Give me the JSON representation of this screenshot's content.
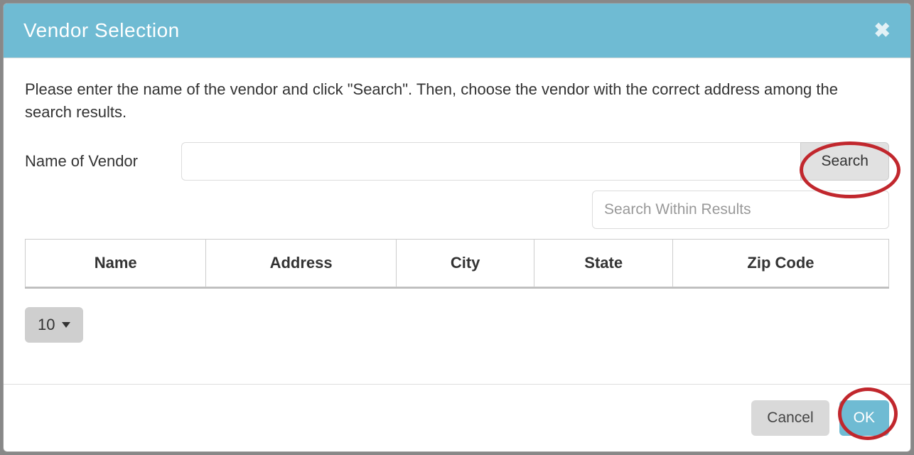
{
  "modal": {
    "title": "Vendor Selection",
    "instructions": "Please enter the name of the vendor and click \"Search\". Then, choose the vendor with the correct address among the search results.",
    "vendor_label": "Name of Vendor",
    "vendor_value": "",
    "search_button": "Search",
    "within_placeholder": "Search Within Results",
    "within_value": ""
  },
  "table": {
    "columns": [
      "Name",
      "Address",
      "City",
      "State",
      "Zip Code"
    ],
    "rows": []
  },
  "pager": {
    "page_size": "10"
  },
  "footer": {
    "cancel": "Cancel",
    "ok": "OK"
  },
  "highlights": {
    "search_button": true,
    "ok_button": true
  }
}
